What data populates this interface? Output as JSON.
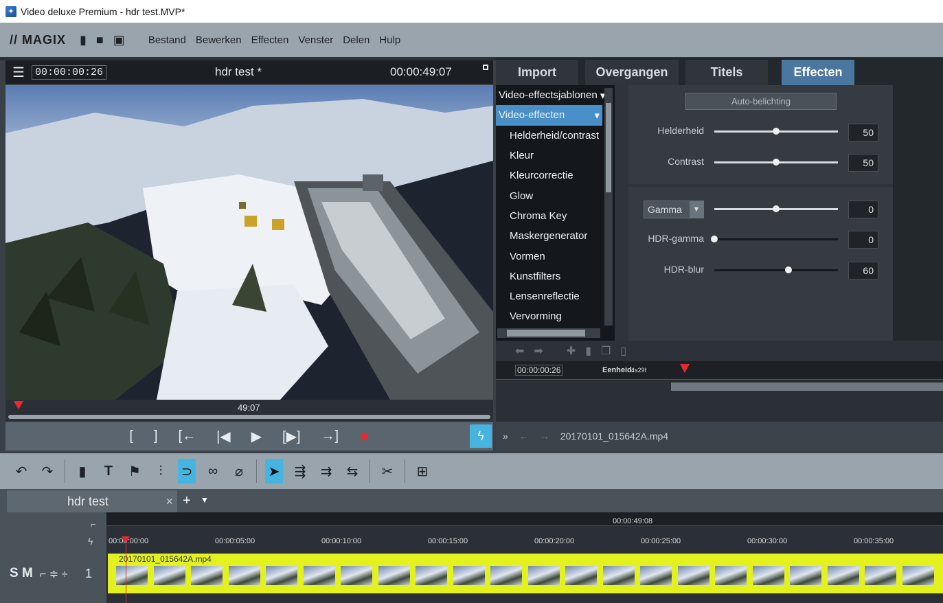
{
  "window": {
    "title": "Video deluxe Premium - hdr test.MVP*"
  },
  "menu": {
    "logo": "// MAGIX",
    "items": [
      "Bestand",
      "Bewerken",
      "Effecten",
      "Venster",
      "Delen",
      "Hulp"
    ]
  },
  "preview": {
    "current_time": "00:00:00:26",
    "project_title": "hdr test *",
    "duration": "00:00:49:07",
    "ruler_end_label": "49:07",
    "transport": [
      "[",
      "]",
      "[←",
      "|◀",
      "▶",
      "[▶]",
      "→]",
      "●"
    ]
  },
  "right_tabs": [
    "Import",
    "Overgangen",
    "Titels",
    "Effecten"
  ],
  "effects": {
    "templates_header": "Video-effectsjablonen",
    "selected_group": "Video-effecten",
    "items": [
      "Helderheid/contrast",
      "Kleur",
      "Kleurcorrectie",
      "Glow",
      "Chroma Key",
      "Maskergenerator",
      "Vormen",
      "Kunstfilters",
      "Lensenreflectie",
      "Vervorming"
    ]
  },
  "settings": {
    "auto_button": "Auto-belichting",
    "brightness_label": "Helderheid",
    "brightness_value": "50",
    "brightness_level": 0.5,
    "contrast_label": "Contrast",
    "contrast_value": "50",
    "contrast_level": 0.5,
    "gamma_dropdown": "Gamma",
    "gamma_value": "0",
    "gamma_level": 0.5,
    "hdr_gamma_label": "HDR-gamma",
    "hdr_gamma_value": "0",
    "hdr_gamma_level": 0.0,
    "hdr_blur_label": "HDR-blur",
    "hdr_blur_value": "60",
    "hdr_blur_level": 0.6
  },
  "fx_timeline": {
    "time": "00:00:00:26",
    "unit_label": "Eenheid:",
    "unit_value": "4s29f"
  },
  "fx_nav": {
    "filename": "20170101_015642A.mp4"
  },
  "timeline": {
    "tab_label": "hdr test",
    "tab_close": "×",
    "tab_add": "+",
    "top_time": "00:00:49:08",
    "ruler_labels": [
      "00:00:00:00",
      "00:00:05:00",
      "00:00:10:00",
      "00:00:15:00",
      "00:00:20:00",
      "00:00:25:00",
      "00:00:30:00",
      "00:00:35:00"
    ],
    "clip_name": "20170101_015642A.mp4",
    "track_controls": "S M",
    "track_number": "1"
  },
  "colors": {
    "accent": "#4a90c8",
    "clip": "#e3f21e",
    "playhead": "#e8292d"
  }
}
